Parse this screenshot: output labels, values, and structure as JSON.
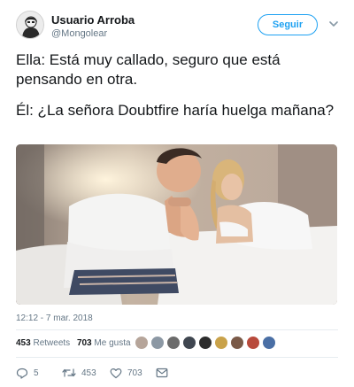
{
  "tweet": {
    "display_name": "Usuario Arroba",
    "handle": "@Mongolear",
    "follow_label": "Seguir",
    "lines": [
      "Ella: Está muy callado, seguro que está pensando en otra.",
      "Él: ¿La señora Doubtfire haría huelga mañana?"
    ],
    "timestamp": "12:12 - 7 mar. 2018"
  },
  "stats": {
    "retweets_count": "453",
    "retweets_label": "Retweets",
    "likes_count": "703",
    "likes_label": "Me gusta"
  },
  "actions": {
    "reply_count": "5",
    "retweet_count": "453",
    "like_count": "703"
  },
  "colors": {
    "accent": "#1da1f2",
    "text": "#14171a",
    "muted": "#657786"
  },
  "icons": [
    "chevron-down-icon",
    "reply-icon",
    "retweet-icon",
    "heart-icon",
    "message-icon"
  ]
}
